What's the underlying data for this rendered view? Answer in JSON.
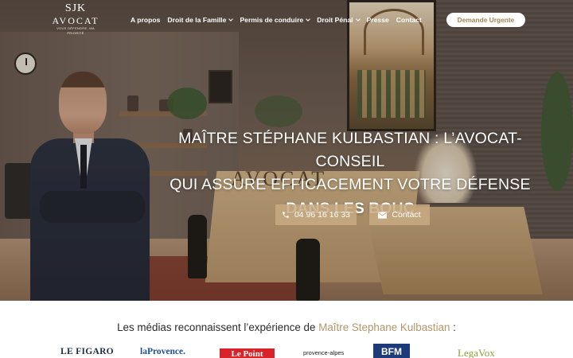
{
  "header": {
    "logo": {
      "mark": "SJK",
      "name": "AVOCAT",
      "tagline": "VOUS DÉFENDRE, MA PRIORITÉ"
    },
    "nav": [
      {
        "label": "A propos",
        "dropdown": false
      },
      {
        "label": "Droit de la Famille",
        "dropdown": true
      },
      {
        "label": "Permis de conduire",
        "dropdown": true
      },
      {
        "label": "Droit Pénal",
        "dropdown": true
      },
      {
        "label": "Presse",
        "dropdown": false
      },
      {
        "label": "Contact",
        "dropdown": false
      }
    ],
    "cta_label": "Demande Urgente"
  },
  "hero": {
    "headline_line1": "MAÎTRE STÉPHANE KULBASTIAN : L’AVOCAT-CONSEIL",
    "headline_line2": "QUI ASSURE EFFICACEMENT VOTRE DÉFENSE",
    "headline_line3": "DANS LES BOUC",
    "phone_button": "04 96 16 16 33",
    "contact_button": "Contact",
    "decor_sign": "AVOCAT"
  },
  "media": {
    "title_prefix": "Les médias reconnaissent l’expérience de ",
    "title_name": "Maître Stephane Kulbastian",
    "title_suffix": " :",
    "logos": [
      "LE FIGARO",
      "laProvence.",
      "Le Point",
      "provence-alpes",
      "BFM",
      "LegaVox"
    ]
  },
  "colors": {
    "accent_gold": "#b5956a",
    "cta_text": "#a2855a",
    "button_bg": "#c8aa82"
  }
}
